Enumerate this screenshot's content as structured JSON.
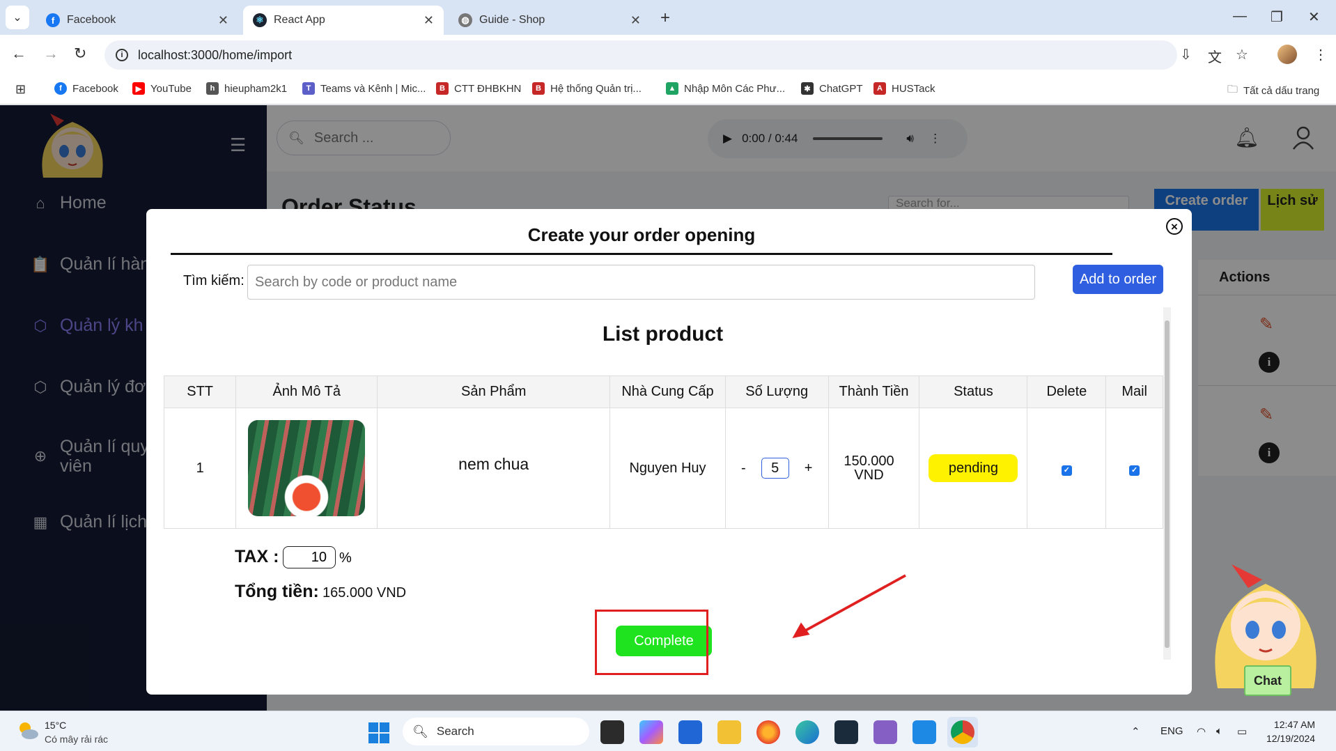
{
  "browser": {
    "tabs": [
      {
        "title": "Facebook",
        "icon": "facebook-icon",
        "color": "#1877f2"
      },
      {
        "title": "React App",
        "icon": "react-icon",
        "color": "#1b2330"
      },
      {
        "title": "Guide - Shop",
        "icon": "globe-icon",
        "color": "#666666"
      }
    ],
    "url": "localhost:3000/home/import",
    "bookmarks": [
      {
        "label": "Facebook",
        "color": "#1877f2",
        "glyph": "f"
      },
      {
        "label": "YouTube",
        "color": "#ff0000",
        "glyph": "▶"
      },
      {
        "label": "hieupham2k1",
        "color": "#555555",
        "glyph": "h"
      },
      {
        "label": "Teams và Kênh | Mic...",
        "color": "#5b5fc7",
        "glyph": "T"
      },
      {
        "label": "CTT ĐHBKHN",
        "color": "#c62828",
        "glyph": "B"
      },
      {
        "label": "Hệ thống Quản trị...",
        "color": "#c62828",
        "glyph": "B"
      },
      {
        "label": "Nhập Môn Các Phư...",
        "color": "#1fa463",
        "glyph": "▲"
      },
      {
        "label": "ChatGPT",
        "color": "#333333",
        "glyph": "✱"
      },
      {
        "label": "HUSTack",
        "color": "#c62828",
        "glyph": "A"
      }
    ],
    "all_bookmarks": "Tất cả dấu trang"
  },
  "app": {
    "search_placeholder": "Search ...",
    "audio_time": "0:00 / 0:44",
    "sidebar": [
      {
        "label": "Home",
        "icon": "home-icon"
      },
      {
        "label": "Quản lí hàn",
        "icon": "clipboard-icon"
      },
      {
        "label": "Quản lý kh",
        "icon": "box-icon"
      },
      {
        "label": "Quản lý đơ",
        "icon": "box-icon"
      },
      {
        "label": "Quản lí quy",
        "label2": "viên",
        "icon": "plus-circle-icon"
      },
      {
        "label": "Quản lí lịch",
        "icon": "calendar-icon"
      }
    ],
    "page_title": "Order Status",
    "page_search_placeholder": "Search for...",
    "create_order": "Create order",
    "history": "Lịch sử",
    "actions_header": "Actions"
  },
  "modal": {
    "title": "Create your order opening",
    "search_label": "Tìm kiếm:",
    "search_placeholder": "Search by code or product name",
    "add_button": "Add to order",
    "list_title": "List product",
    "columns": [
      "STT",
      "Ảnh Mô Tả",
      "Sản Phẩm",
      "Nhà Cung Cấp",
      "Số Lượng",
      "Thành Tiền",
      "Status",
      "Delete",
      "Mail"
    ],
    "rows": [
      {
        "stt": "1",
        "product": "nem chua",
        "supplier": "Nguyen Huy",
        "qty_minus": "-",
        "qty": "5",
        "qty_plus": "+",
        "price_line1": "150.000",
        "price_line2": "VND",
        "status": "pending",
        "delete_checked": true,
        "mail_checked": true
      }
    ],
    "tax_label": "TAX :",
    "tax_value": "10",
    "tax_unit": "%",
    "total_label": "Tổng tiền:",
    "total_value": "165.000 VND",
    "complete_button": "Complete"
  },
  "chat_button": "Chat",
  "taskbar": {
    "weather_temp": "15°C",
    "weather_desc": "Có mây rải rác",
    "search_label": "Search",
    "language": "ENG",
    "time": "12:47 AM",
    "date": "12/19/2024"
  },
  "colors": {
    "sidebar_bg": "#141b33",
    "primary_blue": "#2f5fe0",
    "complete_green": "#1ee31e",
    "pending_yellow": "#fff200",
    "highlight_red": "#e02020"
  }
}
